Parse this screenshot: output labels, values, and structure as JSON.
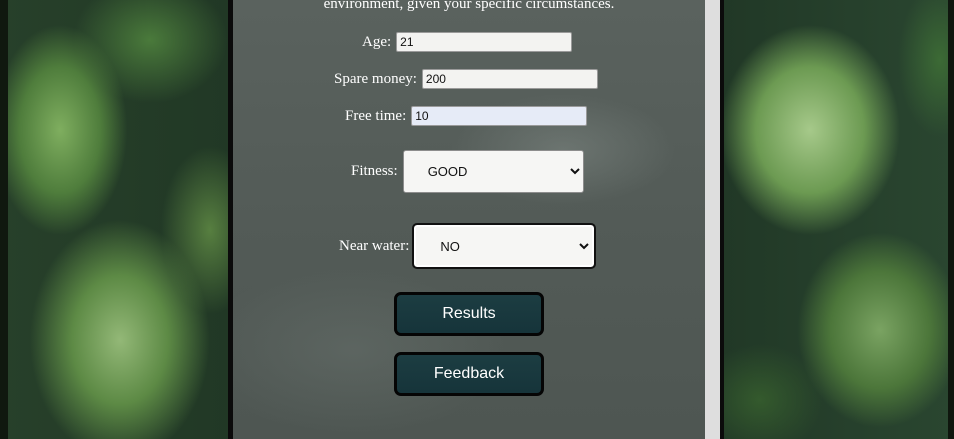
{
  "intro_text": "environment, given your specific circumstances.",
  "form": {
    "age": {
      "label": "Age:",
      "value": "21"
    },
    "spare_money": {
      "label": "Spare money:",
      "value": "200"
    },
    "free_time": {
      "label": "Free time:",
      "value": "10"
    },
    "fitness": {
      "label": "Fitness:",
      "selected": "GOOD"
    },
    "near_water": {
      "label": "Near water:",
      "selected": "NO"
    }
  },
  "buttons": {
    "results": "Results",
    "feedback": "Feedback"
  },
  "colors": {
    "button_bg": "#1c3d42",
    "panel_bg": "#535b57"
  }
}
